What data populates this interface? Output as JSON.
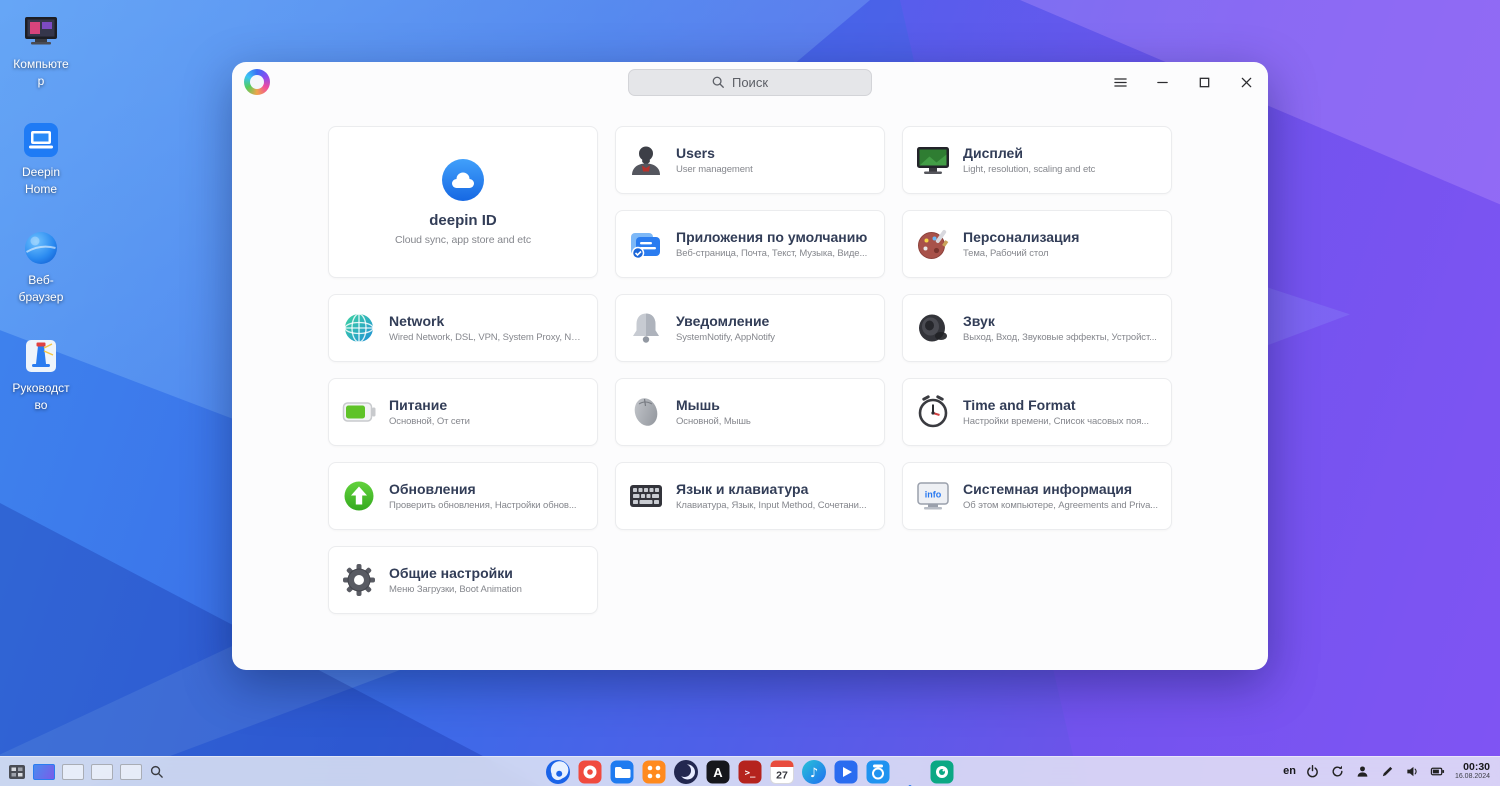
{
  "desktop": {
    "icons": [
      {
        "label": "Компьютер"
      },
      {
        "label": "Deepin Home"
      },
      {
        "label": "Веб-браузер"
      },
      {
        "label": "Руководство"
      }
    ]
  },
  "window": {
    "search": {
      "placeholder": "Поиск"
    },
    "featured": {
      "title": "deepin ID",
      "subtitle": "Cloud sync, app store and etc"
    },
    "cards": [
      {
        "title": "Users",
        "subtitle": "User management"
      },
      {
        "title": "Дисплей",
        "subtitle": "Light, resolution, scaling and etc"
      },
      {
        "title": "Приложения по умолчанию",
        "subtitle": "Веб-страница, Почта, Текст, Музыка, Виде..."
      },
      {
        "title": "Персонализация",
        "subtitle": "Тема, Рабочий стол"
      },
      {
        "title": "Network",
        "subtitle": "Wired Network, DSL, VPN, System Proxy, Net..."
      },
      {
        "title": "Уведомление",
        "subtitle": "SystemNotify, AppNotify"
      },
      {
        "title": "Звук",
        "subtitle": "Выход, Вход, Звуковые эффекты, Устройст..."
      },
      {
        "title": "Питание",
        "subtitle": "Основной, От сети"
      },
      {
        "title": "Мышь",
        "subtitle": "Основной, Мышь"
      },
      {
        "title": "Time and Format",
        "subtitle": "Настройки времени, Список часовых поя..."
      },
      {
        "title": "Обновления",
        "subtitle": "Проверить обновления, Настройки обнов..."
      },
      {
        "title": "Язык и клавиатура",
        "subtitle": "Клавиатура, Язык, Input Method, Сочетани..."
      },
      {
        "title": "Системная информация",
        "subtitle": "Об этом компьютере, Agreements and Priva..."
      },
      {
        "title": "Общие настройки",
        "subtitle": "Меню Загрузки, Boot Animation"
      }
    ]
  },
  "taskbar": {
    "calendar_day": "27",
    "keyboard_layout": "en",
    "time": "00:30",
    "date": "16.08.2024"
  },
  "icon_texts": {
    "sysinfo": "info",
    "editor": "A",
    "terminal": "&gt;_",
    "music": "♪"
  }
}
